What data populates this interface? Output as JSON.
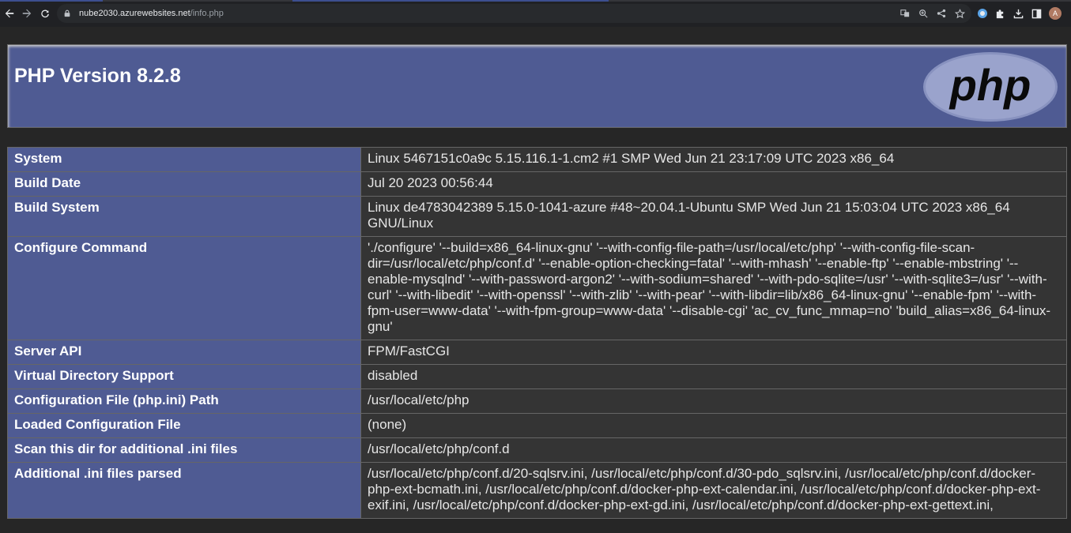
{
  "browser": {
    "url_host": "nube2030.azurewebsites.net",
    "url_path": "/info.php",
    "avatar_letter": "A"
  },
  "page": {
    "title": "PHP Version 8.2.8",
    "logo_text": "php"
  },
  "rows": [
    {
      "key": "System",
      "value": "Linux 5467151c0a9c 5.15.116.1-1.cm2 #1 SMP Wed Jun 21 23:17:09 UTC 2023 x86_64"
    },
    {
      "key": "Build Date",
      "value": "Jul 20 2023 00:56:44"
    },
    {
      "key": "Build System",
      "value": "Linux de4783042389 5.15.0-1041-azure #48~20.04.1-Ubuntu SMP Wed Jun 21 15:03:04 UTC 2023 x86_64 GNU/Linux"
    },
    {
      "key": "Configure Command",
      "value": "'./configure' '--build=x86_64-linux-gnu' '--with-config-file-path=/usr/local/etc/php' '--with-config-file-scan-dir=/usr/local/etc/php/conf.d' '--enable-option-checking=fatal' '--with-mhash' '--enable-ftp' '--enable-mbstring' '--enable-mysqlnd' '--with-password-argon2' '--with-sodium=shared' '--with-pdo-sqlite=/usr' '--with-sqlite3=/usr' '--with-curl' '--with-libedit' '--with-openssl' '--with-zlib' '--with-pear' '--with-libdir=lib/x86_64-linux-gnu' '--enable-fpm' '--with-fpm-user=www-data' '--with-fpm-group=www-data' '--disable-cgi' 'ac_cv_func_mmap=no' 'build_alias=x86_64-linux-gnu'"
    },
    {
      "key": "Server API",
      "value": "FPM/FastCGI"
    },
    {
      "key": "Virtual Directory Support",
      "value": "disabled"
    },
    {
      "key": "Configuration File (php.ini) Path",
      "value": "/usr/local/etc/php"
    },
    {
      "key": "Loaded Configuration File",
      "value": "(none)"
    },
    {
      "key": "Scan this dir for additional .ini files",
      "value": "/usr/local/etc/php/conf.d"
    },
    {
      "key": "Additional .ini files parsed",
      "value": "/usr/local/etc/php/conf.d/20-sqlsrv.ini, /usr/local/etc/php/conf.d/30-pdo_sqlsrv.ini, /usr/local/etc/php/conf.d/docker-php-ext-bcmath.ini, /usr/local/etc/php/conf.d/docker-php-ext-calendar.ini, /usr/local/etc/php/conf.d/docker-php-ext-exif.ini, /usr/local/etc/php/conf.d/docker-php-ext-gd.ini, /usr/local/etc/php/conf.d/docker-php-ext-gettext.ini,"
    }
  ],
  "colors": {
    "header_bg": "#4f5b93",
    "value_bg": "#343434",
    "page_bg": "#262626"
  }
}
